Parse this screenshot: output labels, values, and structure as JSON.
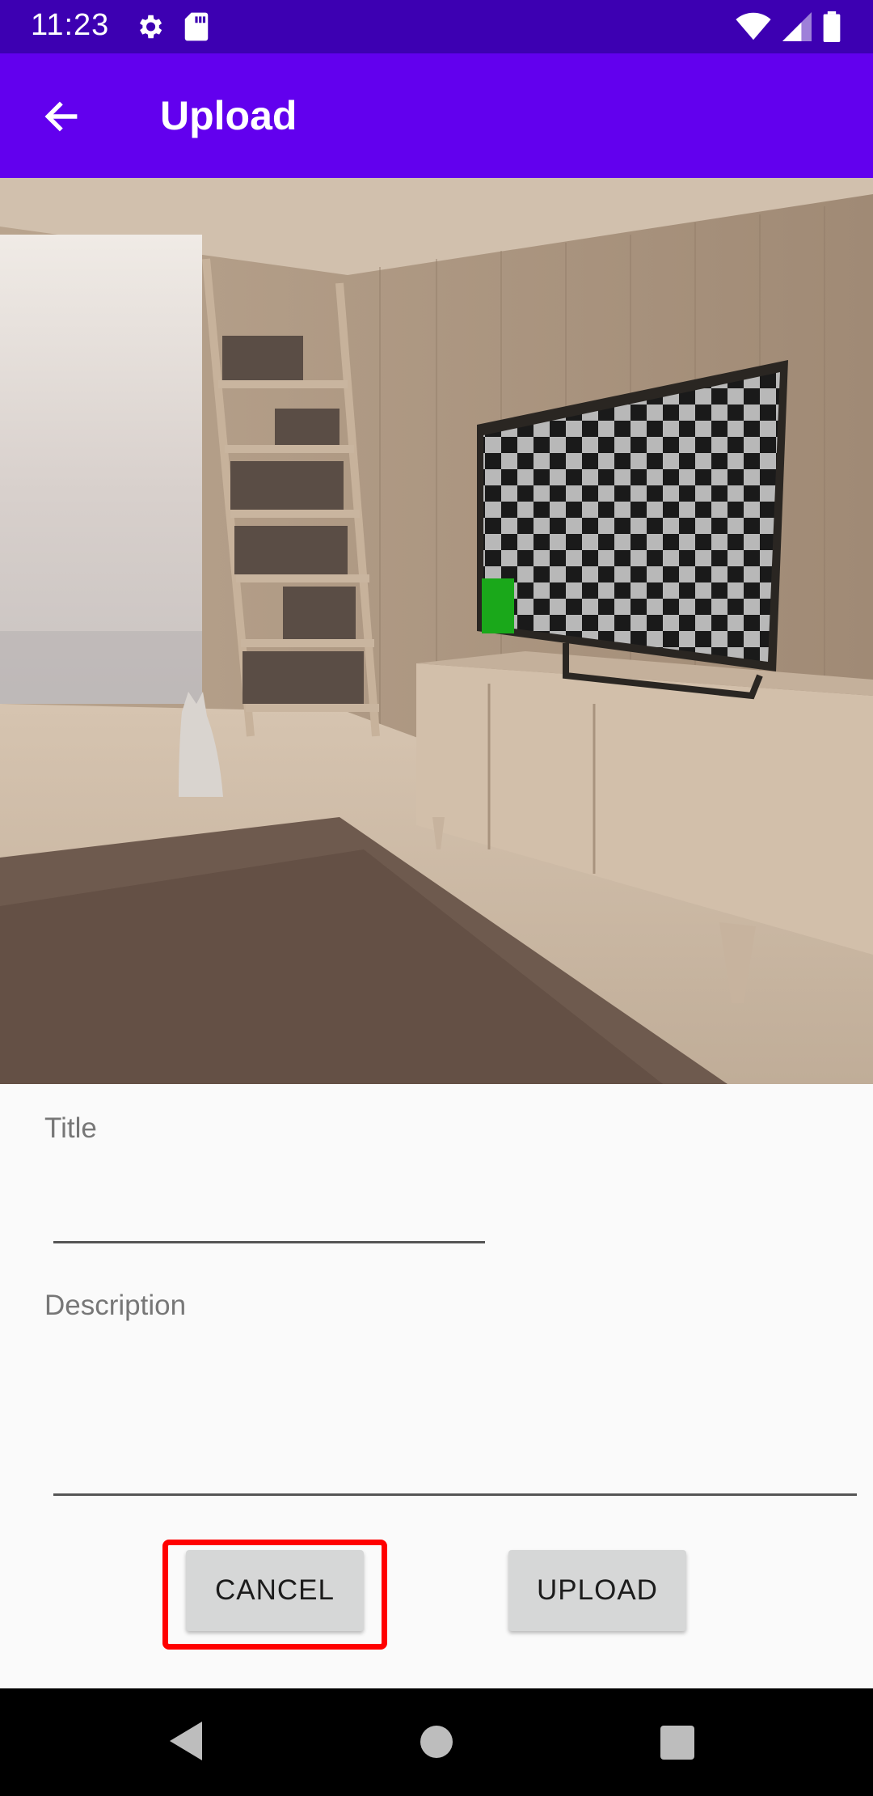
{
  "status_bar": {
    "time": "11:23",
    "icons": [
      "gear-icon",
      "sd-card-icon",
      "wifi-icon",
      "signal-icon",
      "battery-icon"
    ]
  },
  "app_bar": {
    "title": "Upload",
    "back_icon": "arrow-left-icon",
    "color": "#6200ee"
  },
  "form": {
    "title_label": "Title",
    "title_value": "",
    "description_label": "Description",
    "description_value": ""
  },
  "buttons": {
    "cancel": "CANCEL",
    "upload": "UPLOAD"
  },
  "nav_bar": {
    "icons": [
      "nav-back-icon",
      "nav-home-icon",
      "nav-recents-icon"
    ]
  },
  "colors": {
    "status_bar": "#3d00b2",
    "app_bar": "#6200ee",
    "highlight": "#ff0000"
  }
}
